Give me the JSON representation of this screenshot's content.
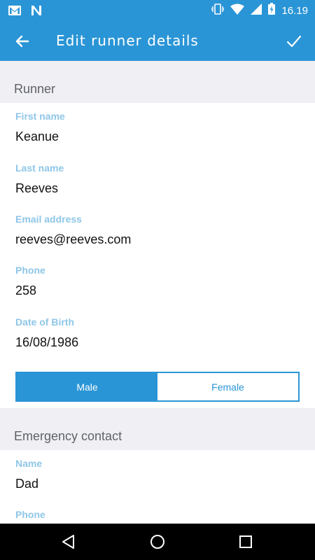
{
  "status_bar": {
    "time": "16.19",
    "icons": [
      "gmail-icon",
      "n-notification-icon",
      "vibrate-icon",
      "wifi-icon",
      "signal-icon",
      "battery-charging-icon"
    ]
  },
  "app_bar": {
    "title": "Edit runner details",
    "back_icon": "arrow-left-icon",
    "confirm_icon": "check-icon"
  },
  "runner_section": {
    "header": "Runner",
    "fields": [
      {
        "label": "First name",
        "value": "Keanue"
      },
      {
        "label": "Last name",
        "value": "Reeves"
      },
      {
        "label": "Email address",
        "value": "reeves@reeves.com"
      },
      {
        "label": "Phone",
        "value": "258"
      },
      {
        "label": "Date of Birth",
        "value": "16/08/1986"
      }
    ],
    "gender": {
      "options": [
        "Male",
        "Female"
      ],
      "selected": "Male"
    }
  },
  "emergency_section": {
    "header": "Emergency contact",
    "fields": [
      {
        "label": "Name",
        "value": "Dad"
      },
      {
        "label": "Phone",
        "value": ""
      }
    ]
  },
  "colors": {
    "primary": "#2a95d6",
    "label": "#8ec6e8",
    "background": "#efeff4"
  },
  "nav_bar": {
    "icons": [
      "back-triangle-icon",
      "home-circle-icon",
      "recents-square-icon"
    ]
  }
}
